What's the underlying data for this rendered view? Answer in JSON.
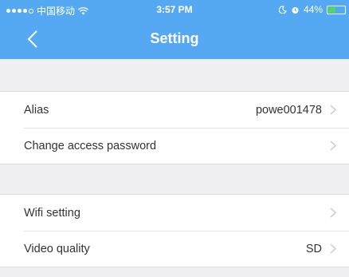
{
  "status_bar": {
    "carrier": "中国移动",
    "time": "3:57 PM",
    "battery_percent": "44%",
    "battery_level": 0.44,
    "icons": [
      "signal-dots-icon",
      "wifi-icon",
      "moon-icon",
      "alarm-icon",
      "battery-icon"
    ]
  },
  "navbar": {
    "title": "Setting",
    "back_icon": "chevron-left-icon"
  },
  "groups": [
    {
      "rows": [
        {
          "label": "Alias",
          "value": "powe001478"
        },
        {
          "label": "Change access password",
          "value": ""
        }
      ]
    },
    {
      "rows": [
        {
          "label": "Wifi setting",
          "value": ""
        },
        {
          "label": "Video quality",
          "value": "SD"
        }
      ]
    }
  ],
  "colors": {
    "header": "#55a9f3",
    "background": "#efeff4",
    "row": "#ffffff",
    "battery": "#4cd964",
    "chevron": "#c7c7cc"
  }
}
